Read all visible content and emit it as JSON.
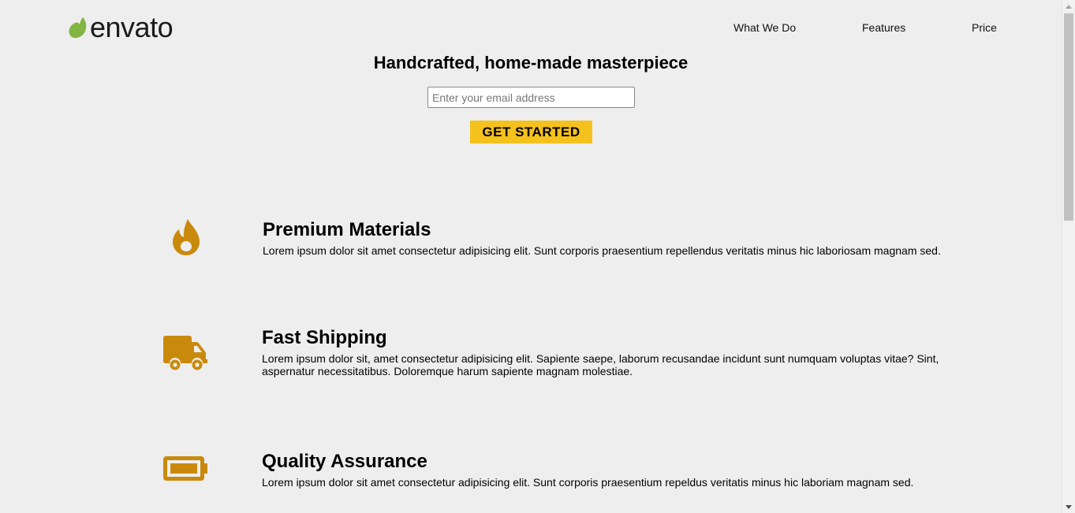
{
  "header": {
    "logo_text": "envato",
    "logo_icon": "leaf-icon",
    "nav": [
      {
        "label": "What We Do"
      },
      {
        "label": "Features"
      },
      {
        "label": "Price"
      }
    ]
  },
  "hero": {
    "title": "Handcrafted, home-made masterpiece",
    "email_placeholder": "Enter your email address",
    "email_value": "",
    "cta_label": "GET STARTED"
  },
  "features": [
    {
      "icon": "fire-icon",
      "title": "Premium Materials",
      "description": "Lorem ipsum dolor sit amet consectetur adipisicing elit. Sunt corporis praesentium repellendus veritatis minus hic laboriosam magnam sed."
    },
    {
      "icon": "truck-icon",
      "title": "Fast Shipping",
      "description": "Lorem ipsum dolor sit, amet consectetur adipisicing elit. Sapiente saepe, laborum recusandae incidunt sunt numquam voluptas vitae? Sint, aspernatur necessitatibus. Doloremque harum sapiente magnam molestiae."
    },
    {
      "icon": "battery-full-icon",
      "title": "Quality Assurance",
      "description": "Lorem ipsum dolor sit amet consectetur adipisicing elit. Sunt corporis praesentium repeldus veritatis minus hic laboriam magnam sed."
    }
  ],
  "colors": {
    "background": "#eeeeee",
    "accent": "#f5c11c",
    "icon": "#c98a0c",
    "logo_leaf": "#82b541"
  }
}
